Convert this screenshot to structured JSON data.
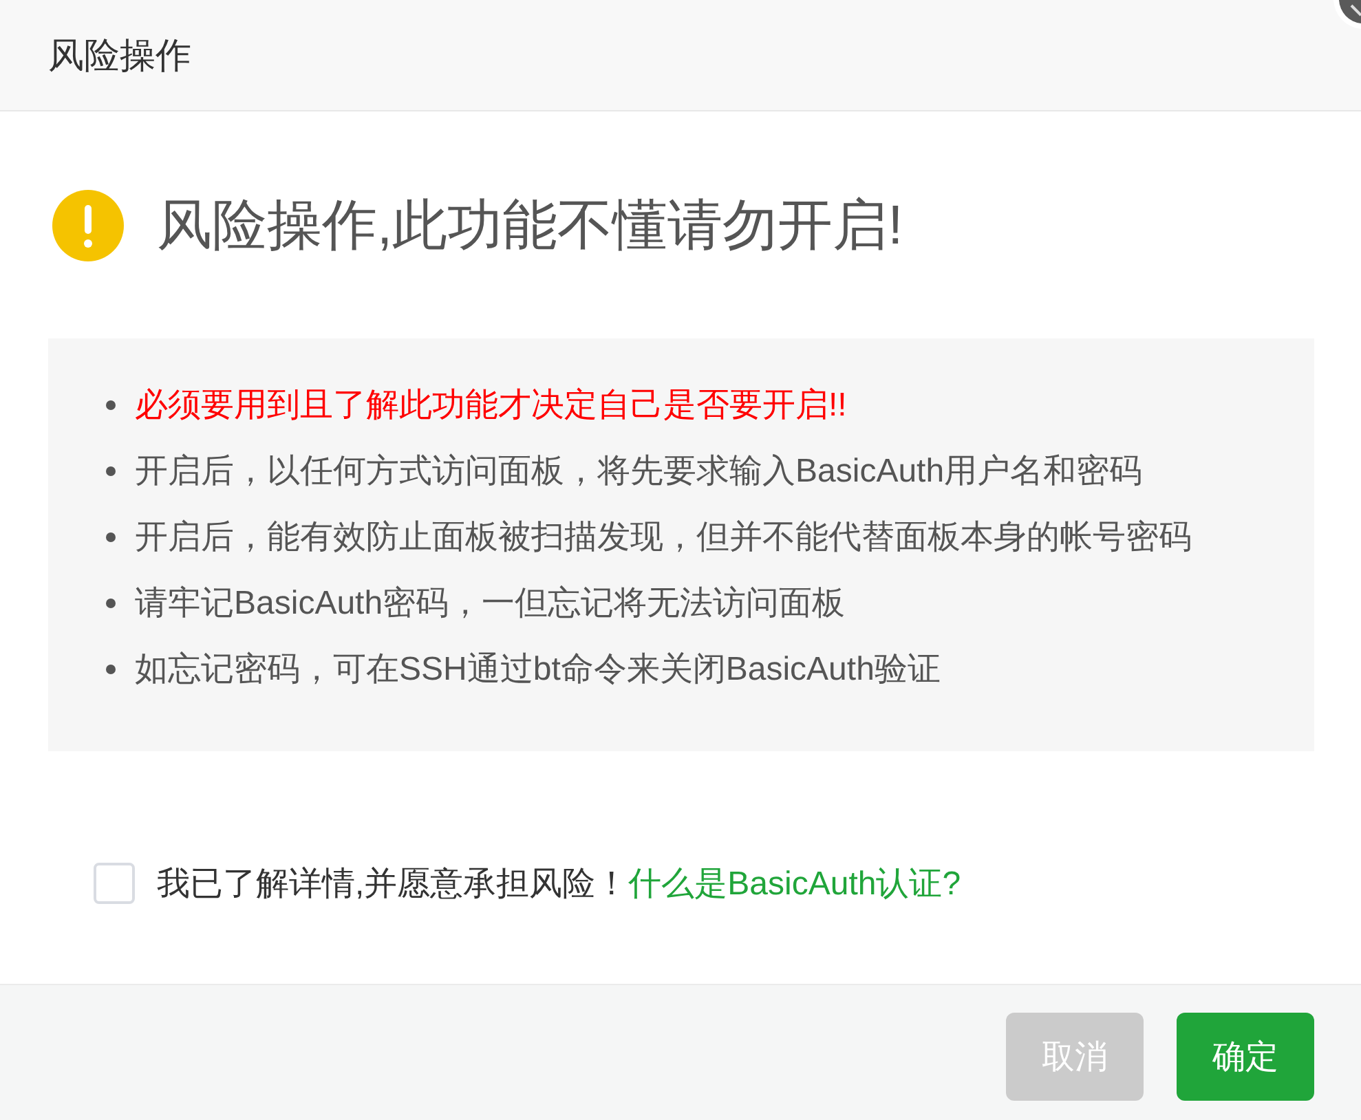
{
  "window": {
    "title": "风险操作"
  },
  "warning": {
    "title": "风险操作,此功能不懂请勿开启!"
  },
  "notes": [
    {
      "kind": "danger",
      "text": "必须要用到且了解此功能才决定自己是否要开启!!"
    },
    {
      "kind": "normal",
      "text": "开启后，以任何方式访问面板，将先要求输入BasicAuth用户名和密码"
    },
    {
      "kind": "normal",
      "text": "开启后，能有效防止面板被扫描发现，但并不能代替面板本身的帐号密码"
    },
    {
      "kind": "normal",
      "text": "请牢记BasicAuth密码，一但忘记将无法访问面板"
    },
    {
      "kind": "normal",
      "text": "如忘记密码，可在SSH通过bt命令来关闭BasicAuth验证"
    }
  ],
  "confirm": {
    "checked": false,
    "label": "我已了解详情,并愿意承担风险！",
    "link": "什么是BasicAuth认证?"
  },
  "buttons": [
    {
      "kind": "cancel",
      "label": "取消"
    },
    {
      "kind": "primary",
      "label": "确定"
    }
  ]
}
